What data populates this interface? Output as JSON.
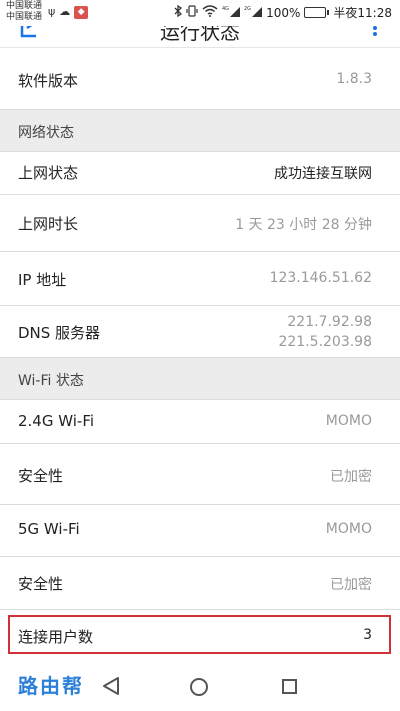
{
  "status_bar": {
    "carrier_1": "中国联通",
    "carrier_2": "中国联通",
    "usb_icon": "ψ",
    "weather_icon": "☁",
    "badge": "◆",
    "sim_label_1": "4G",
    "sim_label_2": "2G",
    "battery": "100%",
    "time": "半夜11:28"
  },
  "header": {
    "title": "运行状态"
  },
  "rows": {
    "software_version": {
      "label": "软件版本",
      "value": "1.8.3"
    },
    "network_section": "网络状态",
    "internet_status": {
      "label": "上网状态",
      "value": "成功连接互联网"
    },
    "online_duration": {
      "label": "上网时长",
      "value": "1 天 23 小时 28 分钟"
    },
    "ip_address": {
      "label": "IP 地址",
      "value": "123.146.51.62"
    },
    "dns_server": {
      "label": "DNS 服务器",
      "value_1": "221.7.92.98",
      "value_2": "221.5.203.98"
    },
    "wifi_section": "Wi-Fi 状态",
    "wifi_24": {
      "label": "2.4G Wi-Fi",
      "value": "MOMO"
    },
    "security_24": {
      "label": "安全性",
      "value": "已加密"
    },
    "wifi_5": {
      "label": "5G Wi-Fi",
      "value": "MOMO"
    },
    "security_5": {
      "label": "安全性",
      "value": "已加密"
    },
    "connected_users": {
      "label": "连接用户数",
      "value": "3"
    }
  },
  "watermark": "路由帮",
  "colors": {
    "accent": "#1a73e8",
    "highlight": "#d0303a",
    "battery": "#3cb043"
  }
}
